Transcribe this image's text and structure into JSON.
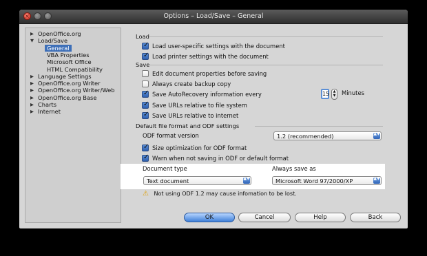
{
  "window": {
    "title": "Options – Load/Save – General",
    "close_glyph": "×"
  },
  "tree": {
    "items": [
      {
        "label": "OpenOffice.org",
        "level": 0,
        "expander": "▶"
      },
      {
        "label": "Load/Save",
        "level": 0,
        "expander": "▼"
      },
      {
        "label": "General",
        "level": 1,
        "selected": true
      },
      {
        "label": "VBA Properties",
        "level": 1
      },
      {
        "label": "Microsoft Office",
        "level": 1
      },
      {
        "label": "HTML Compatibility",
        "level": 1
      },
      {
        "label": "Language Settings",
        "level": 0,
        "expander": "▶"
      },
      {
        "label": "OpenOffice.org Writer",
        "level": 0,
        "expander": "▶"
      },
      {
        "label": "OpenOffice.org Writer/Web",
        "level": 0,
        "expander": "▶"
      },
      {
        "label": "OpenOffice.org Base",
        "level": 0,
        "expander": "▶"
      },
      {
        "label": "Charts",
        "level": 0,
        "expander": "▶"
      },
      {
        "label": "Internet",
        "level": 0,
        "expander": "▶"
      }
    ]
  },
  "load": {
    "heading": "Load",
    "user_settings": {
      "label": "Load user-specific settings with the document",
      "checked": true
    },
    "printer_settings": {
      "label": "Load printer settings with the document",
      "checked": true
    }
  },
  "save": {
    "heading": "Save",
    "edit_props": {
      "label": "Edit document properties before saving",
      "checked": false
    },
    "backup": {
      "label": "Always create backup copy",
      "checked": false
    },
    "autorecovery": {
      "label": "Save AutoRecovery information every",
      "checked": true,
      "minutes": "15",
      "unit": "Minutes"
    },
    "urls_fs": {
      "label": "Save URLs relative to file system",
      "checked": true
    },
    "urls_inet": {
      "label": "Save URLs relative to internet",
      "checked": true
    }
  },
  "defaults": {
    "heading": "Default file format and ODF settings",
    "odf_version_label": "ODF format version",
    "odf_version_value": "1.2 (recommended)",
    "size_opt": {
      "label": "Size optimization for ODF format",
      "checked": true
    },
    "warn_not_odf": {
      "label": "Warn when not saving in ODF or default format",
      "checked": true
    },
    "doc_type_label": "Document type",
    "doc_type_value": "Text document",
    "always_save_label": "Always save as",
    "always_save_value": "Microsoft Word 97/2000/XP",
    "warning_icon": "⚠",
    "warning_text": "Not using ODF 1.2 may cause infomation to be lost."
  },
  "buttons": {
    "ok": "OK",
    "cancel": "Cancel",
    "help": "Help",
    "back": "Back"
  },
  "glyphs": {
    "dropdown": "▲▼",
    "spin_up": "▲",
    "spin_down": "▼"
  },
  "colors": {
    "selection": "#3d6fb8",
    "accent": "#3e7fd8",
    "warning": "#e0a000"
  }
}
